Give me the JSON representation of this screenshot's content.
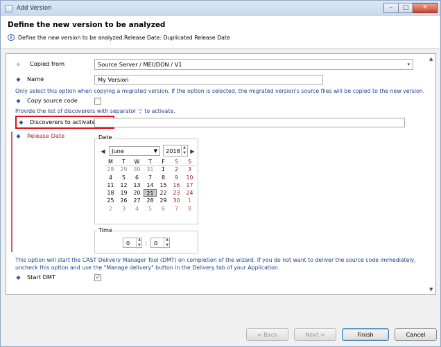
{
  "window": {
    "title": "Add Version"
  },
  "header": {
    "title": "Define the new version to be analyzed",
    "description": "Define the new version to be analyzed.Release Date: Duplicated Release Date"
  },
  "form": {
    "copied_from": {
      "label": "Copied from",
      "value": "Source Server / MEUDON / V1"
    },
    "name": {
      "label": "Name",
      "value": "My Version"
    },
    "copy_note": "Only select this option when copying a migrated version. If the option is selected, the migrated version's source files will be copied to the new version.",
    "copy_source": {
      "label": "Copy source code",
      "checked": false
    },
    "discoverers_note": "Provide the list of discoverers with separator ';' to activate.",
    "discoverers": {
      "label": "Discoverers to activate",
      "value": ""
    },
    "release_date": {
      "label": "Release Date",
      "date_group": "Date",
      "month": "June",
      "year": "2018",
      "weekdays": [
        "M",
        "T",
        "W",
        "T",
        "F",
        "S",
        "S"
      ],
      "weeks": [
        [
          "28",
          "29",
          "30",
          "31",
          "1",
          "2",
          "3"
        ],
        [
          "4",
          "5",
          "6",
          "7",
          "8",
          "9",
          "10"
        ],
        [
          "11",
          "12",
          "13",
          "14",
          "15",
          "16",
          "17"
        ],
        [
          "18",
          "19",
          "20",
          "21",
          "22",
          "23",
          "24"
        ],
        [
          "25",
          "26",
          "27",
          "28",
          "29",
          "30",
          "1"
        ],
        [
          "2",
          "3",
          "4",
          "5",
          "6",
          "7",
          "8"
        ]
      ],
      "selected_day": "21",
      "time_group": "Time",
      "hour": "0",
      "time_sep": ":",
      "minute": "0"
    },
    "dmt_note_1": "This option will start the CAST Delivery Manager Tool (DMT) on completion of the wizard. If you do not want to deliver the source code immediately,",
    "dmt_note_2": "uncheck this option and use the \"Manage delivery\" button in the Delivery tab of your Application.",
    "start_dmt": {
      "label": "Start DMT",
      "checked": true
    }
  },
  "buttons": {
    "back": "< Back",
    "next": "Next >",
    "finish": "Finish",
    "cancel": "Cancel"
  },
  "glyphs": {
    "check": "✓",
    "bullet": "◆",
    "combo_arrow": "▾",
    "prev": "◀",
    "next": "▶",
    "up": "▲",
    "down": "▼",
    "info": "i",
    "minimize": "–",
    "maximize": "□",
    "close": "✕"
  }
}
